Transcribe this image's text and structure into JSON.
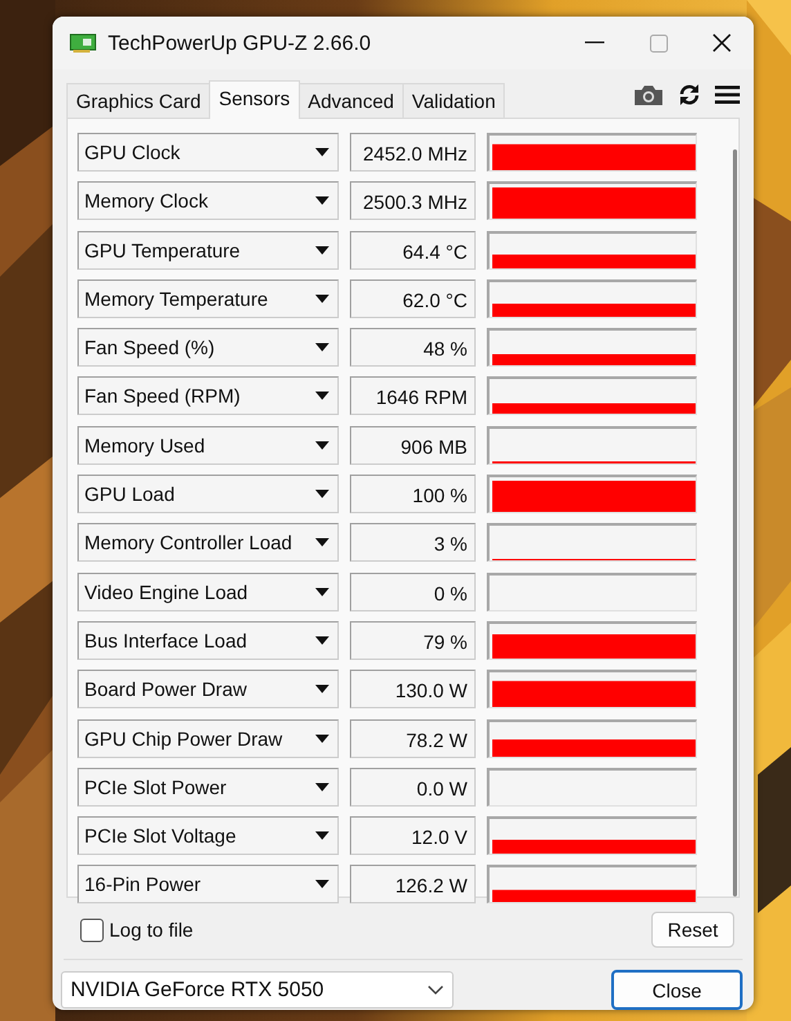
{
  "window": {
    "title": "TechPowerUp GPU-Z 2.66.0"
  },
  "tabs": [
    {
      "label": "Graphics Card",
      "selected": false
    },
    {
      "label": "Sensors",
      "selected": true
    },
    {
      "label": "Advanced",
      "selected": false
    },
    {
      "label": "Validation",
      "selected": false
    }
  ],
  "sensors": [
    {
      "name": "GPU Clock",
      "value": "2452.0 MHz"
    },
    {
      "name": "Memory Clock",
      "value": "2500.3 MHz"
    },
    {
      "name": "GPU Temperature",
      "value": "64.4 °C"
    },
    {
      "name": "Memory Temperature",
      "value": "62.0 °C"
    },
    {
      "name": "Fan Speed (%)",
      "value": "48 %"
    },
    {
      "name": "Fan Speed (RPM)",
      "value": "1646 RPM"
    },
    {
      "name": "Memory Used",
      "value": "906 MB"
    },
    {
      "name": "GPU Load",
      "value": "100 %"
    },
    {
      "name": "Memory Controller Load",
      "value": "3 %"
    },
    {
      "name": "Video Engine Load",
      "value": "0 %"
    },
    {
      "name": "Bus Interface Load",
      "value": "79 %"
    },
    {
      "name": "Board Power Draw",
      "value": "130.0 W"
    },
    {
      "name": "GPU Chip Power Draw",
      "value": "78.2 W"
    },
    {
      "name": "PCIe Slot Power",
      "value": "0.0 W"
    },
    {
      "name": "PCIe Slot Voltage",
      "value": "12.0 V"
    },
    {
      "name": "16-Pin Power",
      "value": "126.2 W"
    }
  ],
  "log_to_file": {
    "label": "Log to file",
    "checked": false
  },
  "reset_button": "Reset",
  "device": {
    "value": "NVIDIA GeForce RTX 5050"
  },
  "close_button": "Close"
}
